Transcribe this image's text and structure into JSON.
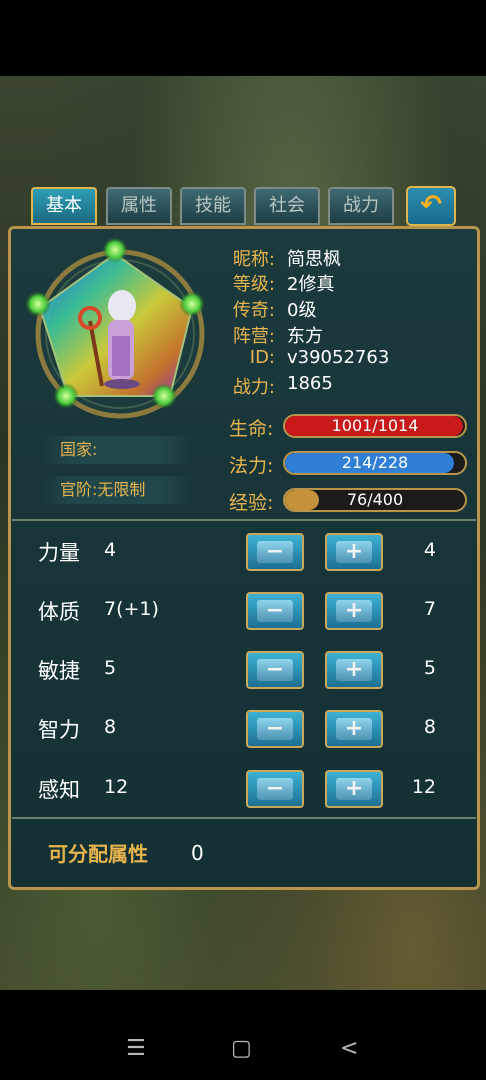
{
  "tabs": [
    "基本",
    "属性",
    "技能",
    "社会",
    "战力"
  ],
  "active_tab": "基本",
  "back_button": "↶",
  "character": {
    "nickname_label": "昵称:",
    "nickname": "简思枫",
    "level_label": "等级:",
    "level": "2修真",
    "legend_label": "传奇:",
    "legend": "0级",
    "faction_label": "阵营:",
    "faction": "东方",
    "id_label": "ID:",
    "id": "v39052763",
    "power_label": "战力:",
    "power": "1865"
  },
  "nation_text": "国家:",
  "official_text": "官阶:无限制",
  "bars": {
    "hp": {
      "label": "生命:",
      "text": "1001/1014",
      "fraction": 0.987,
      "color": "#c8191b"
    },
    "mp": {
      "label": "法力:",
      "text": "214/228",
      "fraction": 0.939,
      "color": "#2f7fd6"
    },
    "exp": {
      "label": "经验:",
      "text": "76/400",
      "fraction": 0.19,
      "color": "#c4923b"
    }
  },
  "attributes": [
    {
      "name": "力量",
      "base": "4",
      "final": "4"
    },
    {
      "name": "体质",
      "base": "7(+1)",
      "final": "7"
    },
    {
      "name": "敏捷",
      "base": "5",
      "final": "5"
    },
    {
      "name": "智力",
      "base": "8",
      "final": "8"
    },
    {
      "name": "感知",
      "base": "12",
      "final": "12"
    }
  ],
  "minus_glyph": "−",
  "plus_glyph": "+",
  "allocatable": {
    "label": "可分配属性",
    "value": "0"
  },
  "nav": {
    "menu": "☰",
    "home": "▢",
    "back": "<"
  }
}
